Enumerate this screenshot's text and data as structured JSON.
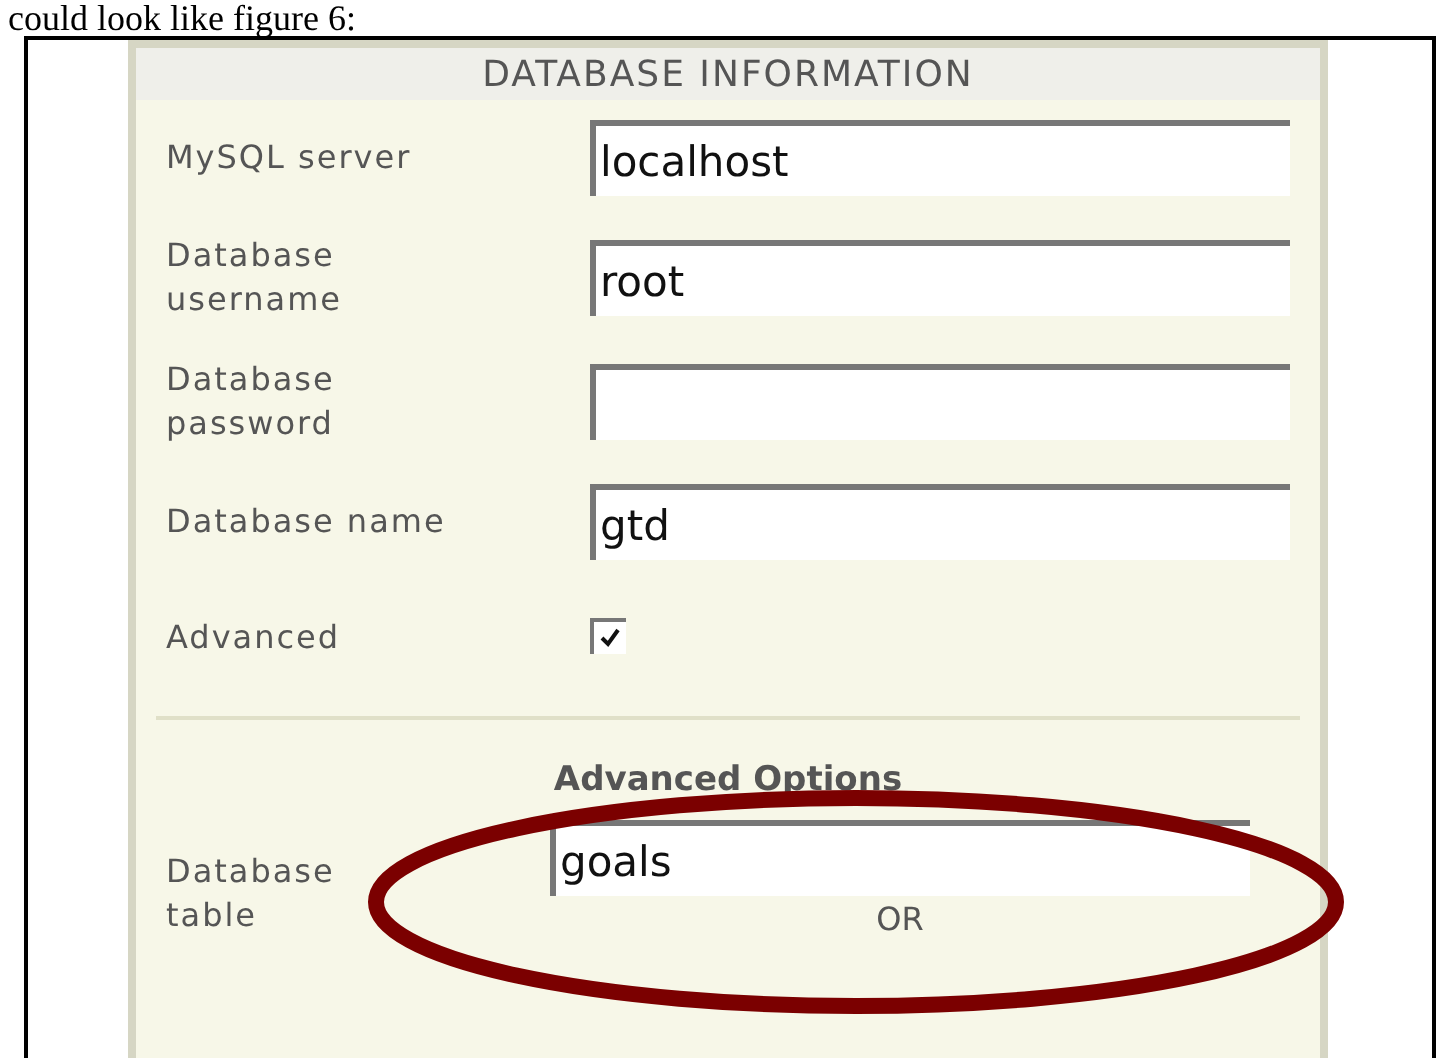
{
  "document": {
    "intro": "could look like figure 6:"
  },
  "panel": {
    "title": "DATABASE INFORMATION",
    "fields": [
      {
        "kind": "text",
        "label": "MySQL server",
        "value": "localhost"
      },
      {
        "kind": "text",
        "label": "Database username",
        "value": "root"
      },
      {
        "kind": "text",
        "label": "Database password"
      },
      {
        "kind": "text",
        "label": "Database name",
        "value": "gtd"
      },
      {
        "kind": "checkbox",
        "label": "Advanced",
        "checked": true
      }
    ],
    "advanced": {
      "heading": "Advanced Options",
      "label": "Database table",
      "value": "goals",
      "separator": "OR"
    }
  },
  "annotation": {
    "kind": "ellipse",
    "color": "#7b0000"
  }
}
